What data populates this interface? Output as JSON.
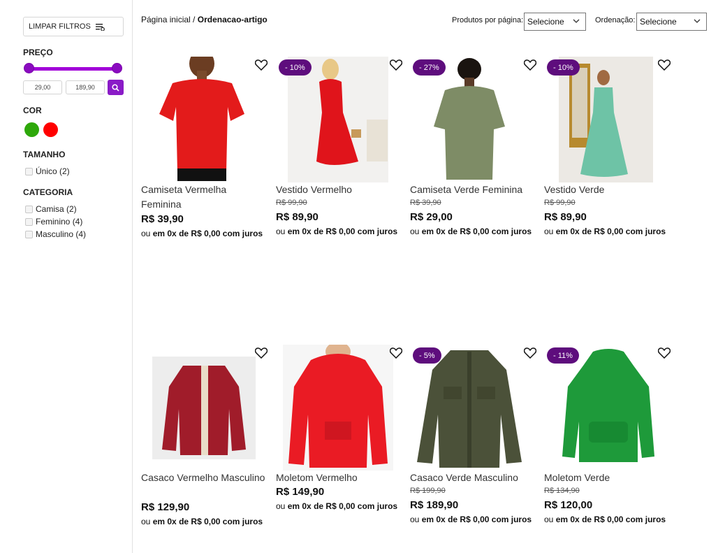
{
  "sidebar": {
    "clear_filters": "LIMPAR FILTROS",
    "price_title": "PREÇO",
    "price_min": "29,00",
    "price_max": "189,90",
    "color_title": "COR",
    "colors": [
      "#2ea80a",
      "#ff0000"
    ],
    "size_title": "TAMANHO",
    "sizes": [
      {
        "label": "Único (2)"
      }
    ],
    "category_title": "CATEGORIA",
    "categories": [
      {
        "label": "Camisa (2)"
      },
      {
        "label": "Feminino (4)"
      },
      {
        "label": "Masculino (4)"
      }
    ]
  },
  "topbar": {
    "breadcrumb_home": "Página inicial",
    "breadcrumb_sep": " / ",
    "breadcrumb_current": "Ordenacao-artigo",
    "per_page_label": "Produtos por página:",
    "per_page_value": "Selecione",
    "sort_label": "Ordenação:",
    "sort_value": "Selecione"
  },
  "products": [
    {
      "name": "Camiseta Vermelha Feminina",
      "old_price": "",
      "price": "R$ 39,90",
      "badge": "",
      "inst_pre": "ou",
      "inst_bold": "em 0x de R$ 0,00 com juros"
    },
    {
      "name": "Vestido Vermelho",
      "old_price": "R$ 99,90",
      "price": "R$ 89,90",
      "badge": "- 10%",
      "inst_pre": "ou",
      "inst_bold": "em 0x de R$ 0,00 com juros"
    },
    {
      "name": "Camiseta Verde Feminina",
      "old_price": "R$ 39,90",
      "price": "R$ 29,00",
      "badge": "- 27%",
      "inst_pre": "ou",
      "inst_bold": "em 0x de R$ 0,00 com juros"
    },
    {
      "name": "Vestido Verde",
      "old_price": "R$ 99,90",
      "price": "R$ 89,90",
      "badge": "- 10%",
      "inst_pre": "ou",
      "inst_bold": "em 0x de R$ 0,00 com juros"
    },
    {
      "name": "Casaco Vermelho Masculino",
      "old_price": "",
      "price": "R$ 129,90",
      "badge": "",
      "inst_pre": "ou",
      "inst_bold": "em 0x de R$ 0,00 com juros"
    },
    {
      "name": "Moletom Vermelho",
      "old_price": "",
      "price": "R$ 149,90",
      "badge": "",
      "inst_pre": "ou",
      "inst_bold": "em 0x de R$ 0,00 com juros"
    },
    {
      "name": "Casaco Verde Masculino",
      "old_price": "R$ 199,90",
      "price": "R$ 189,90",
      "badge": "- 5%",
      "inst_pre": "ou",
      "inst_bold": "em 0x de R$ 0,00 com juros"
    },
    {
      "name": "Moletom Verde",
      "old_price": "R$ 134,90",
      "price": "R$ 120,00",
      "badge": "- 11%",
      "inst_pre": "ou",
      "inst_bold": "em 0x de R$ 0,00 com juros"
    }
  ]
}
